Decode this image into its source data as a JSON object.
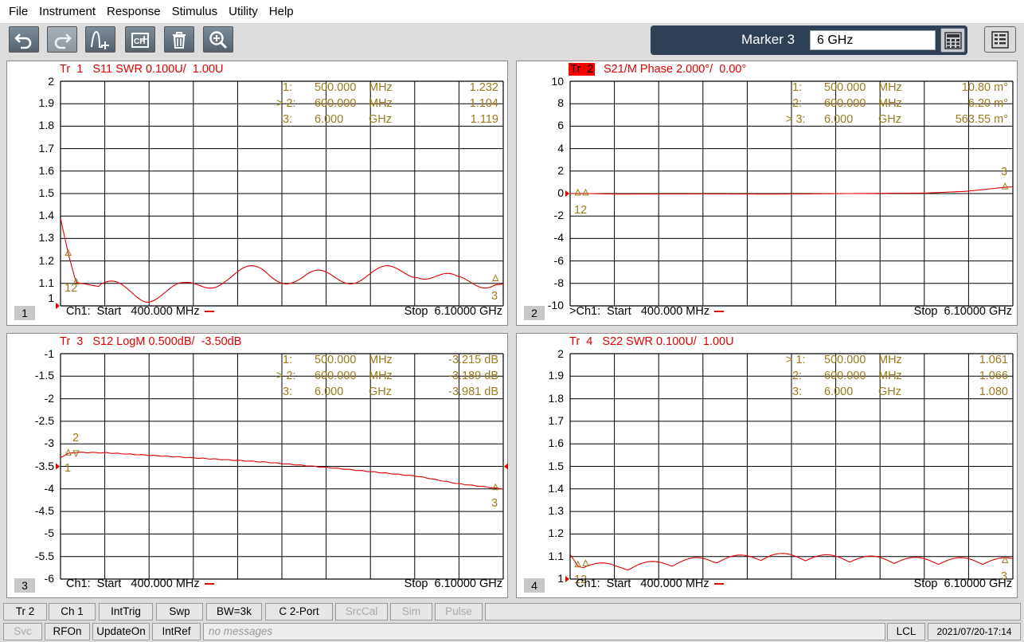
{
  "menu": [
    "File",
    "Instrument",
    "Response",
    "Stimulus",
    "Utility",
    "Help"
  ],
  "toolbar": {
    "icons": [
      "undo-icon",
      "redo-icon",
      "marker-add-icon",
      "channel-icon",
      "trash-icon",
      "zoom-in-icon"
    ],
    "marker_label": "Marker 3",
    "marker_value": "6 GHz"
  },
  "panels": [
    {
      "num": "1",
      "title": "Tr  1   S11 SWR 0.100U/  1.00U",
      "ylabels": [
        "2",
        "1.9",
        "1.8",
        "1.7",
        "1.6",
        "1.5",
        "1.4",
        "1.3",
        "1.2",
        "1.1",
        "1"
      ],
      "markers": [
        {
          "id": "  1:",
          "freq": "500.000",
          "unit": "MHz",
          "val": "1.232"
        },
        {
          "id": "> 2:",
          "freq": "600.000",
          "unit": "MHz",
          "val": "1.104"
        },
        {
          "id": "  3:",
          "freq": "6.000",
          "unit": "GHz",
          "val": "1.119"
        }
      ],
      "start": "Ch1:  Start   400.000 MHz",
      "stop": "Stop  6.10000 GHz",
      "tags": [
        "12",
        "3"
      ]
    },
    {
      "num": "2",
      "title_box": "Tr  2",
      "title": "S21/M Phase 2.000°/  0.00°",
      "ylabels": [
        "10",
        "8",
        "6",
        "4",
        "2",
        "0",
        "-2",
        "-4",
        "-6",
        "-8",
        "-10"
      ],
      "markers": [
        {
          "id": "  1:",
          "freq": "500.000",
          "unit": "MHz",
          "val": "10.80 m°"
        },
        {
          "id": "  2:",
          "freq": "600.000",
          "unit": "MHz",
          "val": "6.20 m°"
        },
        {
          "id": "> 3:",
          "freq": "6.000",
          "unit": "GHz",
          "val": "563.55 m°"
        }
      ],
      "start": ">Ch1:  Start   400.000 MHz",
      "stop": "Stop  6.10000 GHz",
      "tags": [
        "12",
        "3"
      ]
    },
    {
      "num": "3",
      "title": "Tr  3   S12 LogM 0.500dB/  -3.50dB",
      "ylabels": [
        "-1",
        "-1.5",
        "-2",
        "-2.5",
        "-3",
        "-3.5",
        "-4",
        "-4.5",
        "-5",
        "-5.5",
        "-6"
      ],
      "markers": [
        {
          "id": "  1:",
          "freq": "500.000",
          "unit": "MHz",
          "val": "-3.215 dB"
        },
        {
          "id": "> 2:",
          "freq": "600.000",
          "unit": "MHz",
          "val": "-3.189 dB"
        },
        {
          "id": "  3:",
          "freq": "6.000",
          "unit": "GHz",
          "val": "-3.981 dB"
        }
      ],
      "start": "Ch1:  Start   400.000 MHz",
      "stop": "Stop  6.10000 GHz",
      "tags": [
        "2",
        "1",
        "3"
      ]
    },
    {
      "num": "4",
      "title": "Tr  4   S22 SWR 0.100U/  1.00U",
      "ylabels": [
        "2",
        "1.9",
        "1.8",
        "1.7",
        "1.6",
        "1.5",
        "1.4",
        "1.3",
        "1.2",
        "1.1",
        "1"
      ],
      "markers": [
        {
          "id": "> 1:",
          "freq": "500.000",
          "unit": "MHz",
          "val": "1.061"
        },
        {
          "id": "  2:",
          "freq": "600.000",
          "unit": "MHz",
          "val": "1.066"
        },
        {
          "id": "  3:",
          "freq": "6.000",
          "unit": "GHz",
          "val": "1.080"
        }
      ],
      "start": "Ch1:  Start   400.000 MHz",
      "stop": "Stop  6.10000 GHz",
      "tags": [
        "12",
        "3"
      ]
    }
  ],
  "softkeys1": [
    "Tr 2",
    "Ch 1",
    "IntTrig",
    "Swp",
    "BW=3k",
    "C  2-Port",
    "SrcCal",
    "Sim",
    "Pulse"
  ],
  "softkeys2": [
    "Svc",
    "RFOn",
    "UpdateOn",
    "IntRef"
  ],
  "message": "no messages",
  "lcl": "LCL",
  "datetime": "2021/07/20-17:14",
  "colors": {
    "trace": "#e00000",
    "marker": "#9b7a1c",
    "marker_panel": "#2f3f55",
    "active_trace_box": "#ff0000"
  },
  "chart_data": [
    {
      "type": "line",
      "title": "Tr 1 S11 SWR 0.100U/ 1.00U",
      "x": [
        0.4,
        0.5,
        0.6,
        1.0,
        1.5,
        2.0,
        2.5,
        3.0,
        3.5,
        4.0,
        4.5,
        5.0,
        5.5,
        6.0,
        6.1
      ],
      "series": [
        {
          "name": "S11 SWR",
          "values": [
            1.39,
            1.232,
            1.104,
            1.08,
            1.05,
            1.07,
            1.13,
            1.15,
            1.12,
            1.13,
            1.14,
            1.16,
            1.1,
            1.119,
            1.1
          ]
        }
      ],
      "ylim": [
        1,
        2
      ],
      "xlim": [
        0.4,
        6.1
      ]
    },
    {
      "type": "line",
      "title": "Tr 2 S21/M Phase 2.000°/ 0.00°",
      "x": [
        0.4,
        0.5,
        0.6,
        1.0,
        2.0,
        3.0,
        4.0,
        5.0,
        5.5,
        6.0,
        6.1
      ],
      "series": [
        {
          "name": "S21/M Phase",
          "values": [
            0.0,
            0.0108,
            0.0062,
            -0.05,
            -0.03,
            -0.05,
            0.0,
            0.05,
            0.2,
            0.56,
            0.6
          ]
        }
      ],
      "ylim": [
        -10,
        10
      ],
      "xlim": [
        0.4,
        6.1
      ]
    },
    {
      "type": "line",
      "title": "Tr 3 S12 LogM 0.500dB/ -3.50dB",
      "x": [
        0.4,
        0.5,
        0.6,
        1.0,
        2.0,
        3.0,
        4.0,
        5.0,
        5.5,
        6.0,
        6.1
      ],
      "series": [
        {
          "name": "S12 LogM",
          "values": [
            -3.3,
            -3.215,
            -3.189,
            -3.2,
            -3.3,
            -3.4,
            -3.55,
            -3.72,
            -3.88,
            -3.981,
            -4.0
          ]
        }
      ],
      "ylim": [
        -6,
        -1
      ],
      "xlim": [
        0.4,
        6.1
      ]
    },
    {
      "type": "line",
      "title": "Tr 4 S22 SWR 0.100U/ 1.00U",
      "x": [
        0.4,
        0.5,
        0.6,
        1.0,
        2.0,
        3.0,
        4.0,
        5.0,
        5.5,
        6.0,
        6.1
      ],
      "series": [
        {
          "name": "S22 SWR",
          "values": [
            1.1,
            1.061,
            1.066,
            1.05,
            1.08,
            1.1,
            1.09,
            1.08,
            1.08,
            1.08,
            1.08
          ]
        }
      ],
      "ylim": [
        1,
        2
      ],
      "xlim": [
        0.4,
        6.1
      ]
    }
  ]
}
